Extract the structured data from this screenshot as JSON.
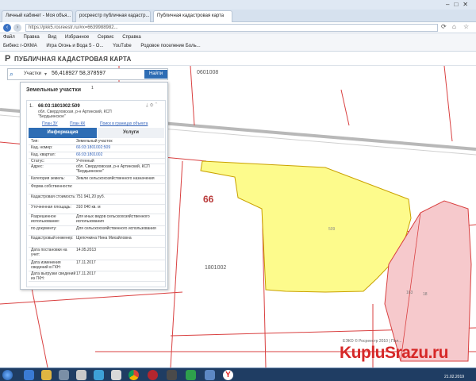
{
  "browser": {
    "tabs": [
      {
        "label": "Личный кабинет - Моя объя..."
      },
      {
        "label": "росреестр публичная кадастр..."
      },
      {
        "label": "Публичная кадастровая карта"
      }
    ],
    "url": "https://pkk5.rosreestr.ru/#x=6639988982...",
    "menu": [
      "Файл",
      "Правка",
      "Вид",
      "Избранное",
      "Сервис",
      "Справка"
    ],
    "bookmarks": [
      "Бибекс г-ОКМА",
      "Игра Огонь и Вода 5 - О...",
      "YouTube",
      "Родовое поселение Боль..."
    ]
  },
  "header": {
    "title": "ПУБЛИЧНАЯ КАДАСТРОВАЯ КАРТА"
  },
  "search": {
    "category": "Участки",
    "value": "56,418927 58,378597",
    "button": "Найти"
  },
  "panel": {
    "title": "Земельные участки",
    "count": "1",
    "item_number": "1.",
    "cad_number": "66:03:1801002:509",
    "address_short": "обл. Свердловская, р-н Артинский, КСП \"Бердыинское\"",
    "links": [
      "План ЗУ",
      "План КК",
      "Поиск в границах объекта"
    ],
    "tabs": {
      "info": "Информация",
      "services": "Услуги"
    },
    "rows": [
      {
        "k": "Тип:",
        "v": "Земельный участок",
        "link": false
      },
      {
        "k": "Кад. номер:",
        "v": "66:03:1801002:509",
        "link": true
      },
      {
        "k": "Кад. квартал:",
        "v": "66:03:1801002",
        "link": true
      },
      {
        "k": "Статус:",
        "v": "Учтенный",
        "link": false
      },
      {
        "k": "Адрес:",
        "v": "обл. Свердловская, р-н Артинский, КСП \"Бердыинское\"",
        "link": false
      },
      {
        "k": "Категория земель:",
        "v": "Земли сельскохозяйственного назначения",
        "link": false
      },
      {
        "k": "Форма собственности:",
        "v": "",
        "link": false
      },
      {
        "k": "Кадастровая стоимость:",
        "v": "751 941,20 руб.",
        "link": false
      },
      {
        "k": "Уточненная площадь:",
        "v": "310 040 кв. м",
        "link": false
      },
      {
        "k": "Разрешенное использование:",
        "v": "Для иных видов сельскохозяйственного использования",
        "link": false
      },
      {
        "k": "по документу:",
        "v": "Для сельскохозяйственного использования",
        "link": false
      },
      {
        "k": "Кадастровый инженер:",
        "v": "Щепочкина Нина Михайловна",
        "link": false
      },
      {
        "k": "Дата постановки на учет:",
        "v": "14.05.2013",
        "link": false
      },
      {
        "k": "Дата изменения сведений в ГКН:",
        "v": "17.11.2017",
        "link": false
      },
      {
        "k": "Дата выгрузки сведений из ГКН:",
        "v": "17.11.2017",
        "link": false
      }
    ]
  },
  "map": {
    "labels": {
      "top_block": "0601008",
      "region": "66",
      "parcel": "509",
      "lower_block": "1801002",
      "pink_a": "163",
      "pink_b": "18"
    },
    "copyright": "ЕЭКО © Росреестр 2010 | Пол..."
  },
  "watermark": "KupluSrazu.ru",
  "taskbar": {
    "clock": "21.02.2019"
  },
  "colors": {
    "parcel_yellow": "#fdfb8c",
    "parcel_pink": "#f6c9cc",
    "boundary_red": "#d94040",
    "accent_blue": "#2e6db4"
  }
}
